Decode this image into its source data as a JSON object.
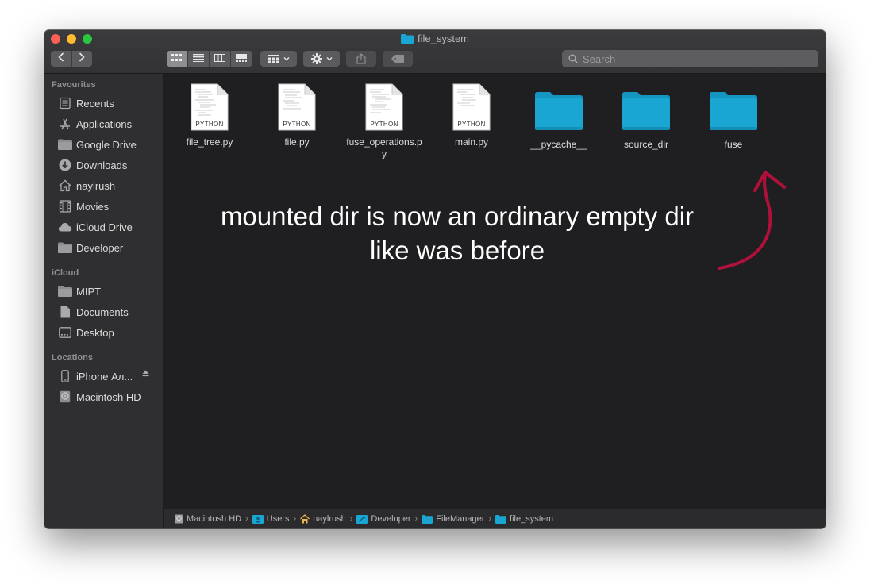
{
  "window": {
    "title": "file_system"
  },
  "toolbar": {
    "back_icon": "chevron-left-icon",
    "forward_icon": "chevron-right-icon",
    "view_modes": [
      "icon-view",
      "list-view",
      "column-view",
      "gallery-view"
    ],
    "active_view": "icon-view",
    "search_placeholder": "Search"
  },
  "sidebar": {
    "sections": [
      {
        "title": "Favourites",
        "items": [
          {
            "label": "Recents",
            "icon": "recents-icon"
          },
          {
            "label": "Applications",
            "icon": "applications-icon"
          },
          {
            "label": "Google Drive",
            "icon": "folder-icon"
          },
          {
            "label": "Downloads",
            "icon": "downloads-icon"
          },
          {
            "label": "naylrush",
            "icon": "home-icon"
          },
          {
            "label": "Movies",
            "icon": "movies-icon"
          },
          {
            "label": "iCloud Drive",
            "icon": "cloud-icon"
          },
          {
            "label": "Developer",
            "icon": "folder-icon"
          }
        ]
      },
      {
        "title": "iCloud",
        "items": [
          {
            "label": "MIPT",
            "icon": "folder-icon"
          },
          {
            "label": "Documents",
            "icon": "document-icon"
          },
          {
            "label": "Desktop",
            "icon": "desktop-icon"
          }
        ]
      },
      {
        "title": "Locations",
        "items": [
          {
            "label": "iPhone Ал...",
            "icon": "iphone-icon"
          },
          {
            "label": "Macintosh HD",
            "icon": "disk-icon"
          }
        ]
      }
    ]
  },
  "files": [
    {
      "name": "file_tree.py",
      "kind": "python",
      "badge": "PYTHON"
    },
    {
      "name": "file.py",
      "kind": "python",
      "badge": "PYTHON"
    },
    {
      "name": "fuse_operations.py",
      "kind": "python",
      "badge": "PYTHON"
    },
    {
      "name": "main.py",
      "kind": "python",
      "badge": "PYTHON"
    },
    {
      "name": "__pycache__",
      "kind": "folder"
    },
    {
      "name": "source_dir",
      "kind": "folder"
    },
    {
      "name": "fuse",
      "kind": "folder"
    }
  ],
  "annotation": {
    "line1": "mounted dir is now an ordinary empty dir",
    "line2": "like was before",
    "arrow_color": "#b0113a"
  },
  "pathbar": [
    {
      "label": "Macintosh HD",
      "icon": "disk-icon"
    },
    {
      "label": "Users",
      "icon": "users-folder-icon"
    },
    {
      "label": "naylrush",
      "icon": "home-icon"
    },
    {
      "label": "Developer",
      "icon": "developer-folder-icon"
    },
    {
      "label": "FileManager",
      "icon": "folder-icon"
    },
    {
      "label": "file_system",
      "icon": "folder-icon"
    }
  ],
  "colors": {
    "folder": "#1aa6d2",
    "folder_tab": "#1596c0",
    "sidebar_bg": "#2f2e30",
    "content_bg": "#1f1e20"
  }
}
